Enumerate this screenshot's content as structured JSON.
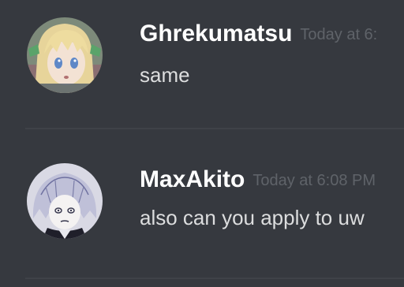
{
  "messages": [
    {
      "username": "Ghrekumatsu",
      "timestamp": "Today at 6:",
      "content": "same",
      "avatar_icon": "anime-girl-avatar-icon"
    },
    {
      "username": "MaxAkito",
      "timestamp": "Today at 6:08 PM",
      "content": "also can you apply to uw",
      "avatar_icon": "anime-character-avatar-icon"
    }
  ],
  "colors": {
    "background": "#36393f",
    "username": "#ffffff",
    "timestamp": "#5f6369",
    "message_text": "#dcddde",
    "divider": "#3f4248"
  }
}
